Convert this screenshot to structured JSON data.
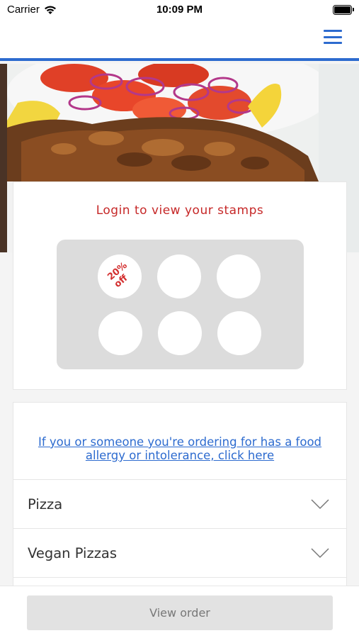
{
  "status_bar": {
    "carrier": "Carrier",
    "time": "10:09 PM",
    "wifi_icon": "wifi-icon",
    "battery_icon": "battery-icon"
  },
  "header": {
    "menu_icon": "hamburger-menu-icon",
    "accent_color": "#2d6bcf"
  },
  "loyalty": {
    "title": "Login to view your stamps",
    "reward_line1": "20%",
    "reward_line2": "off",
    "stamp_count": 6,
    "title_color": "#c62828"
  },
  "allergy": {
    "line1": "If you or someone you're ordering for has a food",
    "line2": "allergy or intolerance, click here"
  },
  "categories": [
    {
      "label": "Pizza"
    },
    {
      "label": "Vegan Pizzas"
    },
    {
      "label": ""
    }
  ],
  "footer": {
    "view_order_label": "View order"
  }
}
